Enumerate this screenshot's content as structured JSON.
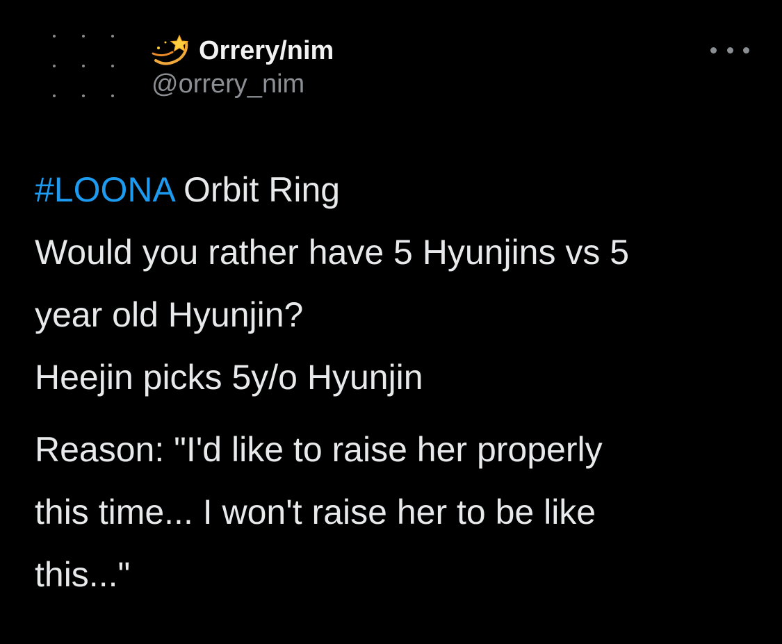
{
  "user": {
    "display_name": "Orrery/nim",
    "handle": "@orrery_nim",
    "badge_icon": "shooting-star-icon"
  },
  "actions": {
    "more_icon": "more-options-icon"
  },
  "tweet": {
    "hashtag": "#LOONA",
    "line1_rest": " Orbit Ring",
    "line2": "Would you rather have 5 Hyunjins vs 5",
    "line3": "year old Hyunjin?",
    "line4": "Heejin picks 5y/o Hyunjin",
    "line5": "Reason: \"I'd like to raise her properly",
    "line6": "this time... I won't raise her to be like",
    "line7": "this...\""
  },
  "colors": {
    "background": "#000000",
    "text": "#e7e9ea",
    "secondary": "#8b8f94",
    "link": "#1d9bf0"
  }
}
